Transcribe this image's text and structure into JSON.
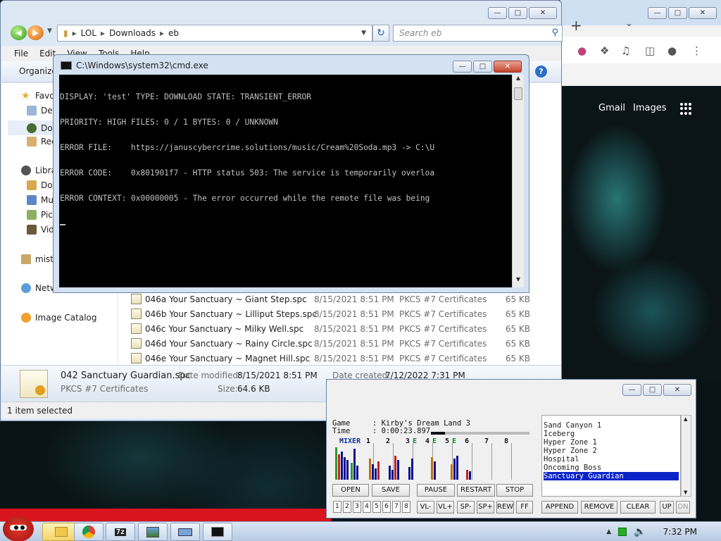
{
  "explorer": {
    "breadcrumb": [
      "LOL",
      "Downloads",
      "eb"
    ],
    "search_placeholder": "Search eb",
    "menu": [
      "File",
      "Edit",
      "View",
      "Tools",
      "Help"
    ],
    "organize_label": "Organize",
    "nav": {
      "favorites": "Favorites",
      "desktop": "Desktop",
      "downloads": "Downloads",
      "recent": "Recent Places",
      "libraries": "Libraries",
      "documents": "Documents",
      "music": "Music",
      "pictures": "Pictures",
      "videos": "Videos",
      "user": "mistake",
      "network": "Network",
      "image_catalog": "Image Catalog"
    },
    "files": [
      {
        "name": "046a Your Sanctuary ~ Giant Step.spc",
        "date": "8/15/2021 8:51 PM",
        "type": "PKCS #7 Certificates",
        "size": "65 KB"
      },
      {
        "name": "046b Your Sanctuary ~ Lilliput Steps.spc",
        "date": "8/15/2021 8:51 PM",
        "type": "PKCS #7 Certificates",
        "size": "65 KB"
      },
      {
        "name": "046c Your Sanctuary ~ Milky Well.spc",
        "date": "8/15/2021 8:51 PM",
        "type": "PKCS #7 Certificates",
        "size": "65 KB"
      },
      {
        "name": "046d Your Sanctuary ~ Rainy Circle.spc",
        "date": "8/15/2021 8:51 PM",
        "type": "PKCS #7 Certificates",
        "size": "65 KB"
      },
      {
        "name": "046e Your Sanctuary ~ Magnet Hill.spc",
        "date": "8/15/2021 8:51 PM",
        "type": "PKCS #7 Certificates",
        "size": "65 KB"
      }
    ],
    "details": {
      "filename": "042 Sanctuary Guardian.spc",
      "type": "PKCS #7 Certificates",
      "date_modified_label": "Date modified:",
      "date_modified": "8/15/2021 8:51 PM",
      "date_created_label": "Date created:",
      "date_created": "7/12/2022 7:31 PM",
      "size_label": "Size:",
      "size": "64.6 KB"
    },
    "status": "1 item selected"
  },
  "cmd": {
    "title": "C:\\Windows\\system32\\cmd.exe",
    "lines": [
      "DISPLAY: 'test' TYPE: DOWNLOAD STATE: TRANSIENT_ERROR",
      "PRIORITY: HIGH FILES: 0 / 1 BYTES: 0 / UNKNOWN",
      "ERROR FILE:    https://januscybercrime.solutions/music/Cream%20Soda.mp3 -> C:\\U",
      "ERROR CODE:    0x801901f7 - HTTP status 503: The service is temporarily overloa",
      "ERROR CONTEXT: 0x00000005 - The error occurred while the remote file was being"
    ]
  },
  "browser": {
    "links": [
      "Gmail",
      "Images"
    ]
  },
  "spc": {
    "game_label": "Game",
    "game": "Kirby's Dream Land 3",
    "time_label": "Time",
    "time": "0:00:23.897",
    "progress": 0.14,
    "mixer_label": "MIXER",
    "channels": [
      "1",
      "2",
      "3",
      "4",
      "5",
      "6",
      "7",
      "8"
    ],
    "echo_marks": [
      "E",
      "E",
      "E"
    ],
    "buttons_row1": [
      "OPEN",
      "SAVE",
      "PAUSE",
      "RESTART",
      "STOP"
    ],
    "buttons_row2": [
      "VL-",
      "VL+",
      "SP-",
      "SP+",
      "REW",
      "FF"
    ],
    "playlist_buttons": [
      "APPEND",
      "REMOVE",
      "CLEAR",
      "UP",
      "DN"
    ],
    "playlist": [
      "Sand Canyon 1",
      "Iceberg",
      "Hyper Zone 1",
      "Hyper Zone 2",
      "Hospital",
      "Oncoming Boss",
      "Sanctuary Guardian"
    ],
    "selected_index": 6
  },
  "taskbar": {
    "clock": "7:32 PM"
  }
}
